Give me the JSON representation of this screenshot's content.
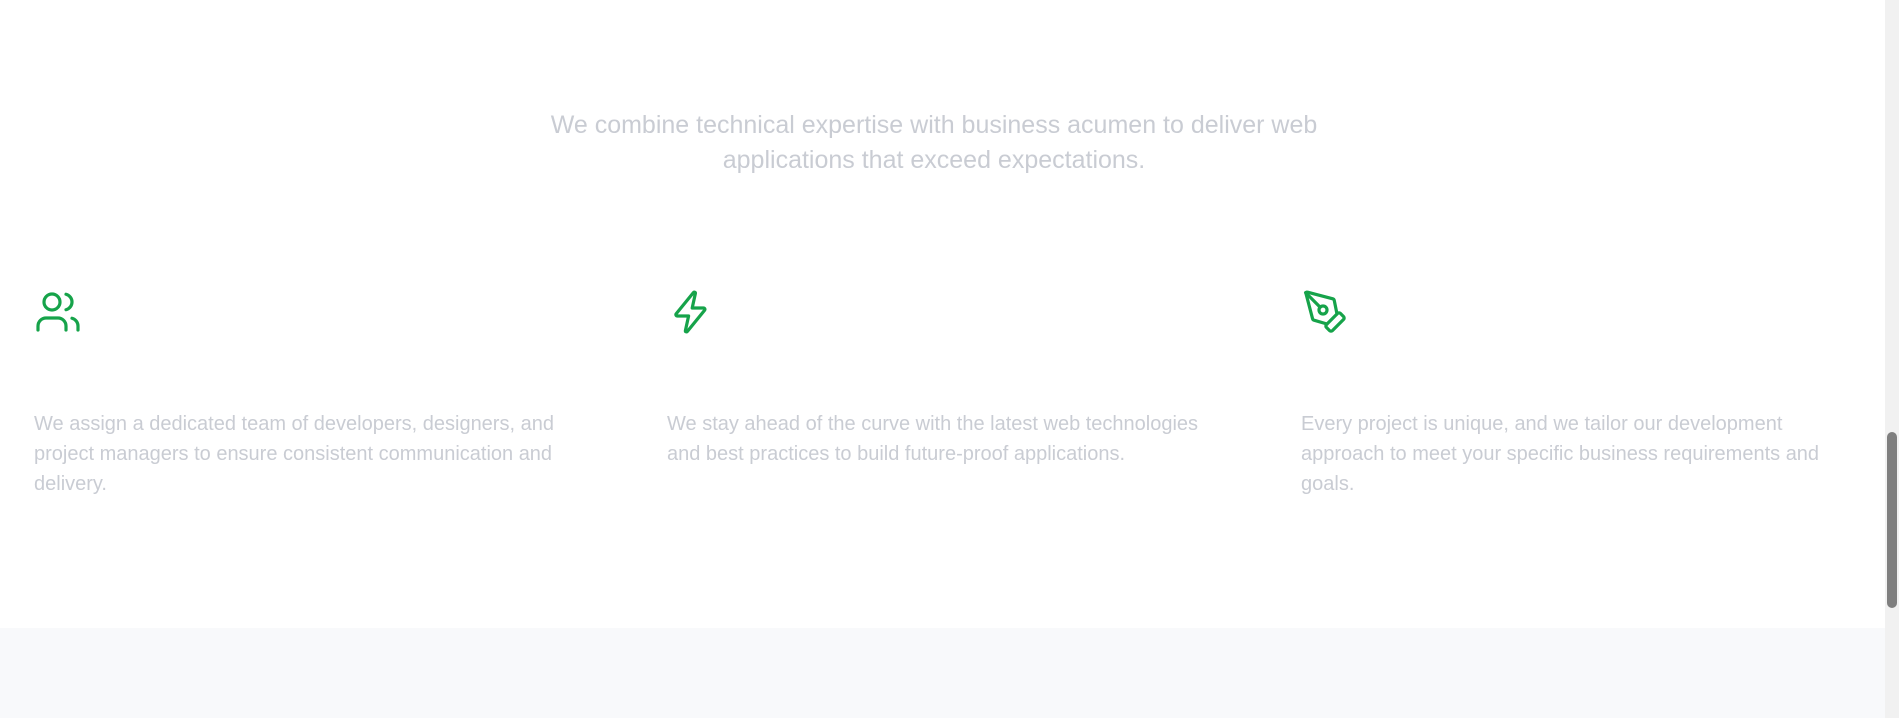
{
  "intro": {
    "subtitle_line1": "We combine technical expertise with business acumen to deliver web",
    "subtitle_line2": "applications that exceed expectations."
  },
  "features": [
    {
      "icon": "users-icon",
      "description": "We assign a dedicated team of developers, designers, and project managers to ensure consistent communication and delivery."
    },
    {
      "icon": "lightning-icon",
      "description": "We stay ahead of the curve with the latest web technologies and best practices to build future-proof applications."
    },
    {
      "icon": "pen-tool-icon",
      "description": "Every project is unique, and we tailor our development approach to meet your specific business requirements and goals."
    }
  ],
  "colors": {
    "accent": "#16a34a",
    "muted_text": "#c9ccd3",
    "next_section_bg": "#f8f9fb"
  }
}
